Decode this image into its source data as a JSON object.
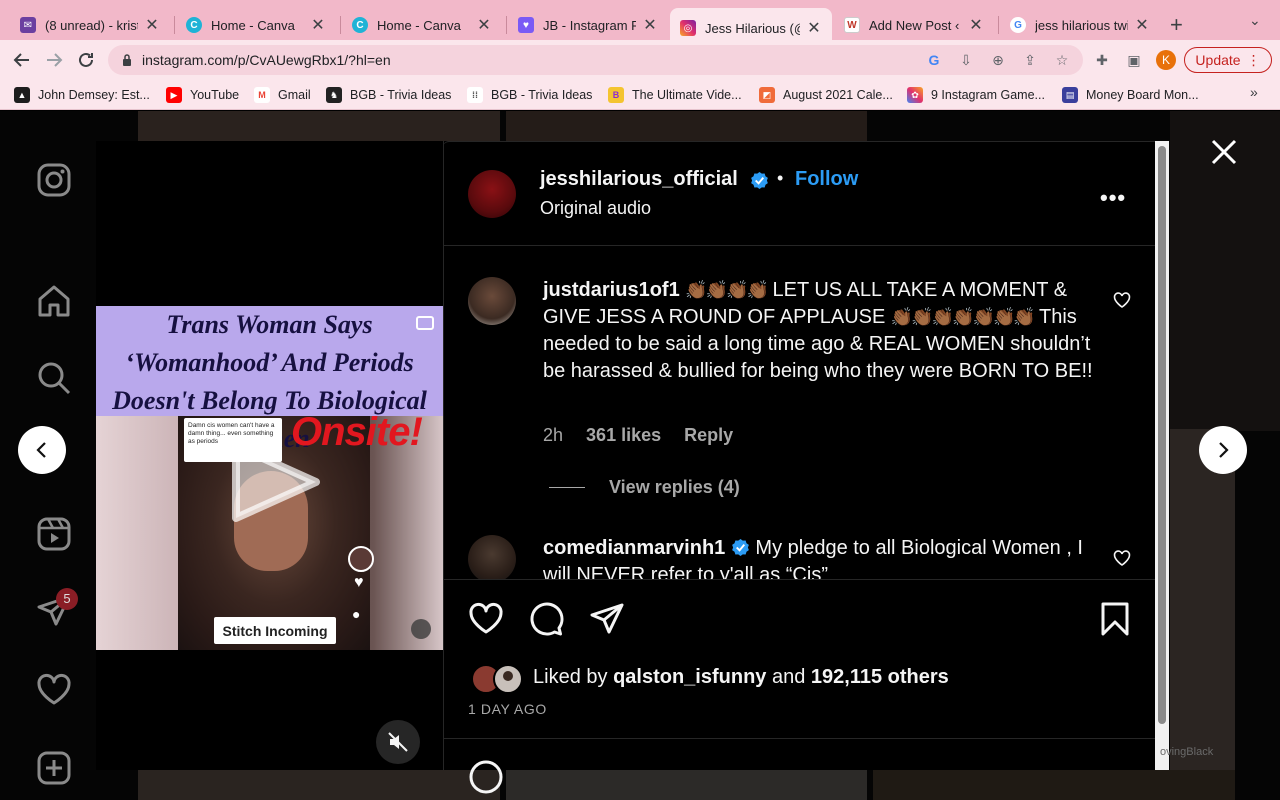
{
  "browser": {
    "tabs": [
      {
        "title": "(8 unread) - kriste",
        "icon": "mail-icon",
        "color": "#6b3fa0"
      },
      {
        "title": "Home - Canva",
        "icon": "canva-icon",
        "color": "#1fb3d6"
      },
      {
        "title": "Home - Canva",
        "icon": "canva-icon",
        "color": "#1fb3d6"
      },
      {
        "title": "JB - Instagram Po",
        "icon": "heart-planner-icon",
        "color": "#7a5af5"
      },
      {
        "title": "Jess Hilarious (@",
        "icon": "instagram-icon",
        "color": "#e1306c"
      },
      {
        "title": "Add New Post ‹ th",
        "icon": "wordpress-icon",
        "color": "#c0392b"
      },
      {
        "title": "jess hilarious twitt",
        "icon": "google-icon",
        "color": "#4285f4"
      }
    ],
    "active_tab": 4,
    "url": "instagram.com/p/CvAUewgRbx1/?hl=en",
    "profile_initial": "K",
    "update_label": "Update",
    "bookmarks": [
      {
        "label": "John Demsey: Est...",
        "color": "#1d1d1d"
      },
      {
        "label": "YouTube",
        "color": "#ff0000"
      },
      {
        "label": "Gmail",
        "color": "#ea4335"
      },
      {
        "label": "BGB - Trivia Ideas",
        "color": "#222222"
      },
      {
        "label": "BGB - Trivia Ideas",
        "color": "#555555"
      },
      {
        "label": "The Ultimate Vide...",
        "color": "#8e2bd1"
      },
      {
        "label": "August 2021 Cale...",
        "color": "#f06b3a"
      },
      {
        "label": "9 Instagram Game...",
        "color": "#e1306c"
      },
      {
        "label": "Money Board Mon...",
        "color": "#3a3f9c"
      }
    ]
  },
  "video": {
    "headline": "Trans Woman Says ‘Womanhood’ And Periods Doesn't Belong To Biological Women",
    "overlay_brand": "Onsite!",
    "bubble_text": "Damn cis women can't have a damn thing... even something as periods",
    "sticker_label": "Stitch Incoming"
  },
  "post": {
    "author": "jesshilarious_official",
    "follow_label": "Follow",
    "audio": "Original audio",
    "liked_by_user": "qalston_isfunny",
    "liked_by_others": "192,115 others",
    "liked_prefix": "Liked by",
    "liked_and": "and",
    "date": "1 DAY AGO"
  },
  "comments": [
    {
      "user": "justdarius1of1",
      "text": "LET US ALL TAKE A MOMENT & GIVE JESS A ROUND OF APPLAUSE",
      "text2": "This needed to be said a long time ago & REAL WOMEN shouldn’t be harassed & bullied for being who they were BORN TO BE!!",
      "time": "2h",
      "likes": "361 likes",
      "reply": "Reply",
      "view_replies": "View replies (4)"
    },
    {
      "user": "comedianmarvinh1",
      "text": "My pledge to all Biological Women , I will NEVER refer to y'all as “Cis”"
    }
  ],
  "colors": {
    "accent": "#2c9cf5",
    "tab_strip": "#f2b8c9",
    "toolbar": "#fbe6ec",
    "notification": "#8a1d25"
  },
  "sidebar": {
    "notification_count": "5"
  },
  "watermark": "ovingBlack"
}
